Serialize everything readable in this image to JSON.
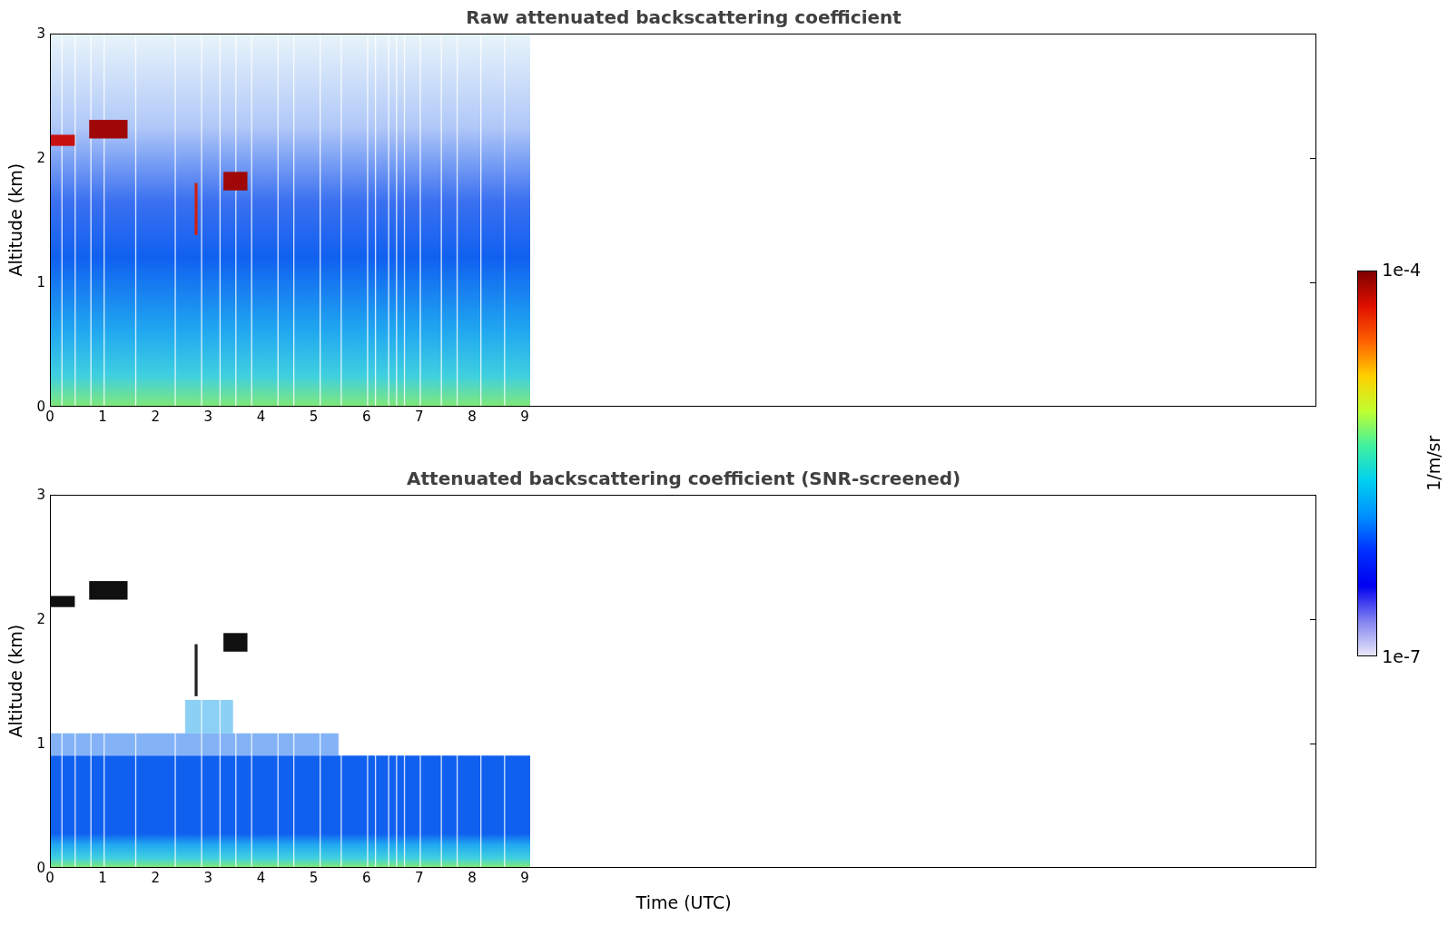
{
  "panels": [
    {
      "kind": "raw",
      "title": "Raw attenuated backscattering coefficient",
      "ylabel": "Altitude (km)",
      "yticks": [
        "3",
        "2",
        "1",
        "0"
      ],
      "xticks": [
        "0",
        "1",
        "2",
        "3",
        "4",
        "5",
        "6",
        "7",
        "8",
        "9"
      ]
    },
    {
      "kind": "screened",
      "title": "Attenuated backscattering coefficient (SNR-screened)",
      "ylabel": "Altitude (km)",
      "yticks": [
        "3",
        "2",
        "1",
        "0"
      ],
      "xticks": [
        "0",
        "1",
        "2",
        "3",
        "4",
        "5",
        "6",
        "7",
        "8",
        "9"
      ]
    }
  ],
  "xlabel": "Time (UTC)",
  "colorbar": {
    "max": "1e-4",
    "min": "1e-7",
    "label": "1/m/sr"
  }
}
